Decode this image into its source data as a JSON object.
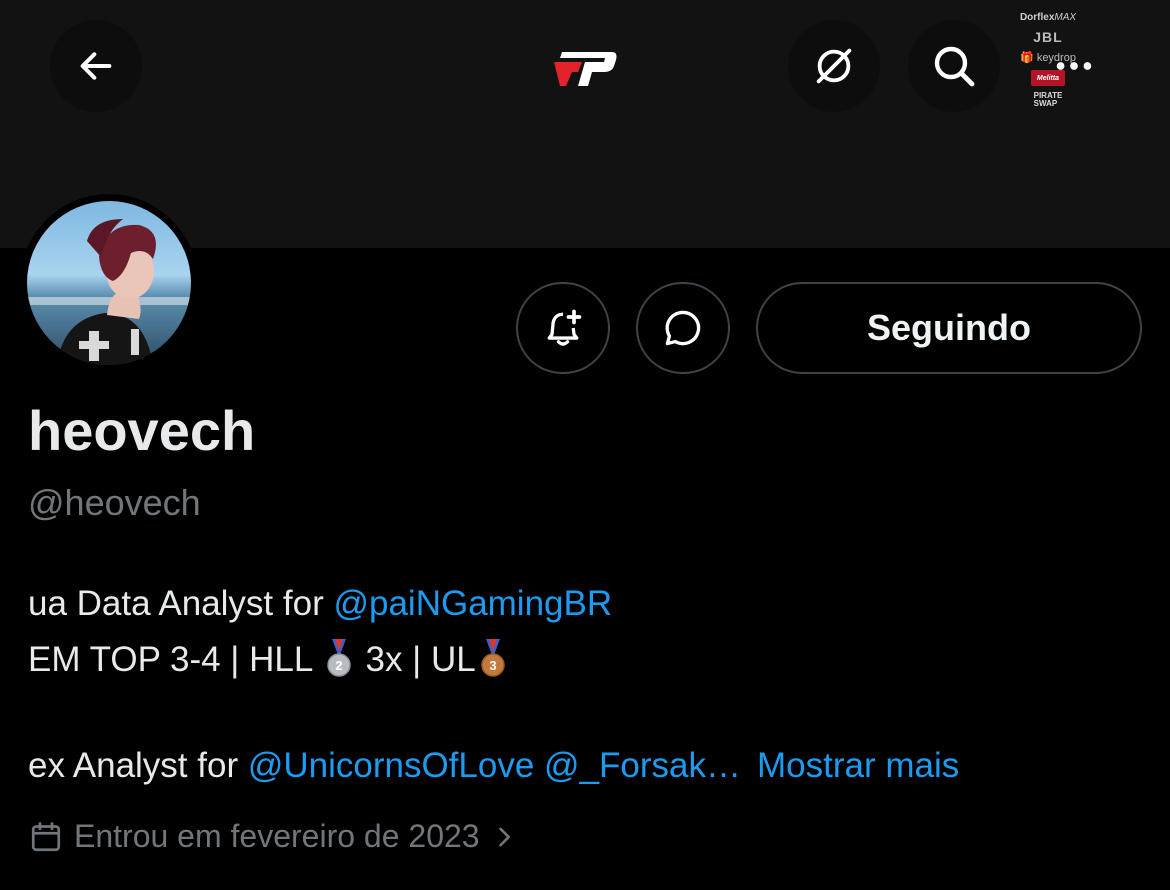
{
  "header": {
    "back_icon": "arrow-left-icon",
    "logo_icon": "pain-gaming-logo",
    "grok_icon": "grok-icon",
    "search_icon": "search-icon",
    "more_icon": "more-horizontal-icon",
    "sponsors": [
      "Dorflex",
      "MAX",
      "JBL",
      "keydrop",
      "Melitta",
      "PIRATE",
      "SWAP"
    ]
  },
  "profile": {
    "display_name": "heovech",
    "handle": "@heovech",
    "follow_label": "Seguindo",
    "notify_icon": "bell-plus-icon",
    "message_icon": "message-bubble-icon"
  },
  "bio": {
    "line1_prefix": "ua Data Analyst for ",
    "line1_mention": "@paiNGamingBR",
    "line2_a": "EM TOP 3-4 | HLL ",
    "line2_b": " 3x | UL",
    "medal_silver": "2",
    "medal_bronze": "3",
    "line3_prefix": "ex Analyst for ",
    "line3_mention1": "@UnicornsOfLove",
    "line3_mention2": "@_Forsak…",
    "show_more": "Mostrar mais"
  },
  "joined": {
    "text": "Entrou em fevereiro de 2023",
    "calendar_icon": "calendar-icon",
    "chevron_icon": "chevron-right-icon"
  },
  "colors": {
    "background": "#000000",
    "banner": "#121212",
    "link": "#1d9bf0",
    "muted": "#71767b",
    "text": "#e7e9ea"
  }
}
